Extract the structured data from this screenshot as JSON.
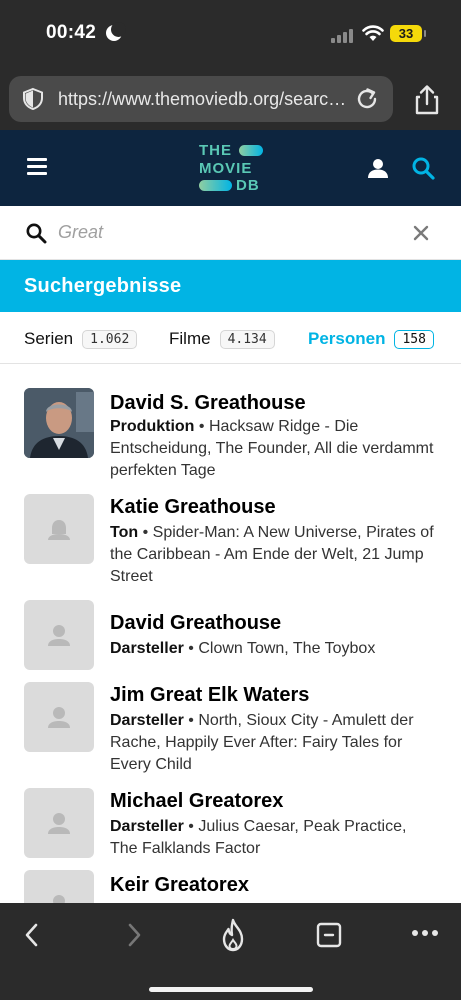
{
  "status_bar": {
    "time": "00:42",
    "battery": "33"
  },
  "browser": {
    "url": "https://www.themoviedb.org/search/person?query=Great"
  },
  "site": {
    "logo_lines": [
      "THE",
      "MOVIE",
      "DB"
    ]
  },
  "search": {
    "placeholder": "Great"
  },
  "banner": {
    "title": "Suchergebnisse"
  },
  "tabs": [
    {
      "label": "Serien",
      "count": "1.062"
    },
    {
      "label": "Filme",
      "count": "4.134"
    },
    {
      "label": "Personen",
      "count": "158"
    }
  ],
  "results": [
    {
      "name": "David S. Greathouse",
      "department": "Produktion",
      "known_for": "Hacksaw Ridge - Die Entscheidung, The Founder, All die verdammt perfekten Tage"
    },
    {
      "name": "Katie Greathouse",
      "department": "Ton",
      "known_for": "Spider-Man: A New Universe, Pirates of the Caribbean - Am Ende der Welt, 21 Jump Street"
    },
    {
      "name": "David Greathouse",
      "department": "Darsteller",
      "known_for": "Clown Town, The Toybox"
    },
    {
      "name": "Jim Great Elk Waters",
      "department": "Darsteller",
      "known_for": "North, Sioux City - Amulett der Rache, Happily Ever After: Fairy Tales for Every Child"
    },
    {
      "name": "Michael Greatorex",
      "department": "Darsteller",
      "known_for": "Julius Caesar, Peak Practice, The Falklands Factor"
    },
    {
      "name": "Keir Greatorex",
      "department": "",
      "known_for": ""
    }
  ],
  "colors": {
    "tmdb_navy": "#0d253f",
    "tmdb_blue": "#01b4e4",
    "tmdb_green": "#90cea1"
  },
  "icons": [
    "shield-icon",
    "reload-icon",
    "share-icon",
    "menu-icon",
    "user-icon",
    "search-icon",
    "close-icon",
    "back-icon",
    "forward-icon",
    "flame-icon",
    "tabs-icon",
    "more-icon"
  ]
}
